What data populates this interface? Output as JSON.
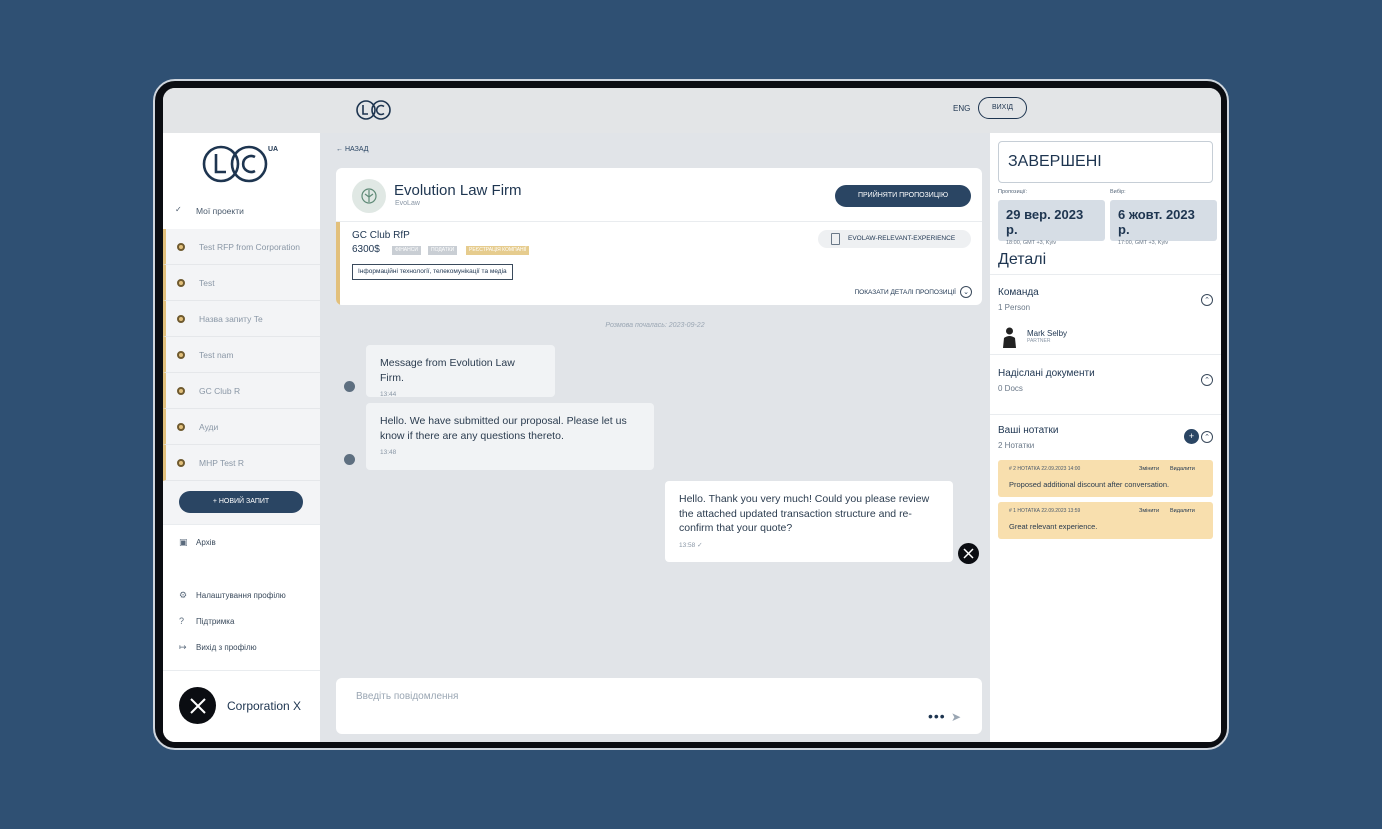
{
  "topbar": {
    "lang": "ENG",
    "logout": "ВИХІД"
  },
  "sidebar": {
    "my_projects": "Мої проекти",
    "projects": [
      "Test RFP from Corporation",
      "Test",
      "Назва запиту Te",
      "Test nam",
      "GC Club R",
      "Ауди",
      "MHP Test R"
    ],
    "new_request": "+ НОВИЙ ЗАПИТ",
    "archive": "Архів",
    "profile_settings": "Налаштування профілю",
    "support": "Підтримка",
    "logout_profile": "Вихід з профілю",
    "company": "Corporation X"
  },
  "main": {
    "back": "НАЗАД",
    "firm": {
      "name": "Evolution Law Firm",
      "sub": "EvoLaw",
      "accept": "ПРИЙНЯТИ ПРОПОЗИЦІЮ"
    },
    "rfp": {
      "title": "GC Club RfP",
      "price": "6300$",
      "tags": [
        "ФІНАНСИ",
        "ПОДАТКИ",
        "РЕЄСТРАЦІЯ КОМПАНІЇ"
      ],
      "industry": "Інформаційні технології, телекомунікації та медіа",
      "file": "EVOLAW-RELEVANT-EXPERIENCE",
      "show_details": "ПОКАЗАТИ ДЕТАЛІ ПРОПОЗИЦІЇ"
    },
    "started": "Розмова почалась: 2023-09-22",
    "messages": [
      {
        "text": "Message from Evolution Law Firm.",
        "time": "13:44"
      },
      {
        "text": "Hello. We have submitted our proposal. Please let us know if there are any questions thereto.",
        "time": "13:48"
      },
      {
        "text": "Hello. Thank you very much! Could you please review the attached updated transaction structure and re-confirm that your quote?",
        "time": "13:58 ✓"
      }
    ],
    "composer": {
      "placeholder": "Введіть повідомлення",
      "more": "•••",
      "send": "➤"
    }
  },
  "right": {
    "status": "ЗАВЕРШЕНІ",
    "proposals_label": "Пропозиції:",
    "selection_label": "Вибір:",
    "proposals_date": "29 вер. 2023 р.",
    "proposals_time": "18:00, GMT +3, Kyiv",
    "selection_date": "6 жовт. 2023 р.",
    "selection_time": "17:00, GMT +3, Kyiv",
    "details": "Деталі",
    "team": {
      "title": "Команда",
      "sub": "1 Person",
      "person_name": "Mark Selby",
      "person_role": "PARTNER"
    },
    "docs": {
      "title": "Надіслані документи",
      "sub": "0 Docs"
    },
    "notes": {
      "title": "Ваші нотатки",
      "sub": "2 Нотатки",
      "plus": "+",
      "items": [
        {
          "meta": "# 2 НОТАТКА  22.09.2023 14:00",
          "edit": "Змінити",
          "delete": "Видалити",
          "text": "Proposed additional discount after conversation."
        },
        {
          "meta": "# 1 НОТАТКА  22.09.2023 13:59",
          "edit": "Змінити",
          "delete": "Видалити",
          "text": "Great relevant experience."
        }
      ]
    }
  },
  "colors": {
    "accent": "#2a4563",
    "gold": "#e2c07c",
    "background": "#2f5073"
  }
}
